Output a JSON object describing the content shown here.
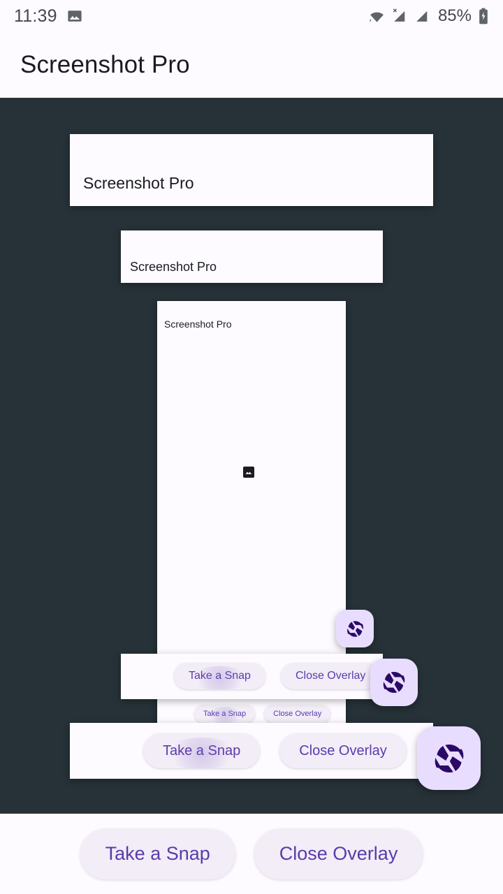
{
  "status_bar": {
    "time": "11:39",
    "battery_percent": "85%",
    "icons": {
      "notification": "gallery-image-icon",
      "wifi": "wifi-icon",
      "sim1": "signal-no-sim-icon",
      "sim2": "signal-bars-icon",
      "battery": "battery-charging-icon"
    }
  },
  "app_bar": {
    "title": "Screenshot Pro"
  },
  "theme": {
    "canvas_bg": "#263238",
    "surface": "#fdfbff",
    "fab_bg": "#e9ddff",
    "fab_icon": "#2a0a66",
    "pill_bg": "#f2edf7",
    "pill_text": "#5b3bab",
    "title_text": "#1b1b1f"
  },
  "buttons": {
    "take_snap": "Take a Snap",
    "close_overlay": "Close Overlay"
  },
  "fab": {
    "icon": "camera-aperture-icon",
    "label": "Take a Snap"
  },
  "previews": [
    {
      "title": "Screenshot Pro"
    },
    {
      "title": "Screenshot Pro"
    },
    {
      "title": "Screenshot Pro"
    },
    {
      "title": "Screenshot Pro"
    },
    {
      "title": "Screenshot Pro"
    }
  ],
  "nested_preview": {
    "title": "Screenshot Pro",
    "image_placeholder": "image-placeholder-icon",
    "take_snap": "Take a Snap",
    "close_overlay": "Close Overlay"
  }
}
